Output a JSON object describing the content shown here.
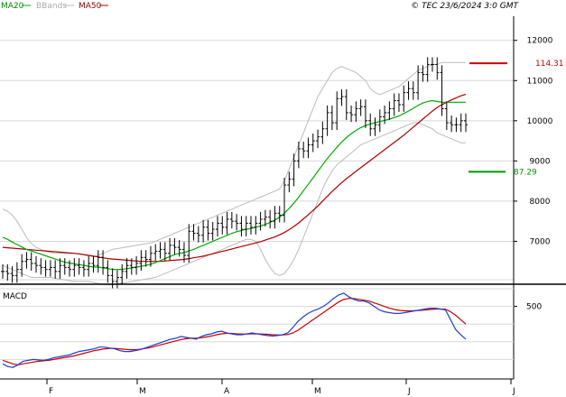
{
  "header": {
    "legend": [
      {
        "name": "MA20",
        "color": "#009900"
      },
      {
        "name": "BBands",
        "color": "#bbbbbb"
      },
      {
        "name": "MA50",
        "color": "#990000"
      }
    ],
    "copyright": "© TEC 23/6/2024 3:0 GMT"
  },
  "colors": {
    "price": "#000000",
    "ma20": "#00aa00",
    "ma50": "#aa0000",
    "bbands": "#bbbbbb",
    "grid": "#d8d8d8",
    "macd": "#1f3fcf",
    "signal": "#cc0000",
    "resistance": "#cc0000",
    "support": "#009900",
    "axis": "#000000"
  },
  "chart_data": [
    {
      "type": "line",
      "title": "",
      "x_labels": [
        "F",
        "M",
        "A",
        "M",
        "J",
        "J"
      ],
      "y_ticks": [
        "12000",
        "11000",
        "10000",
        "9000",
        "8000",
        "7000"
      ],
      "y_tick_values": [
        12000,
        11000,
        10000,
        9000,
        8000,
        7000
      ],
      "ylim": [
        6000,
        12600
      ],
      "grid": true,
      "annotations": [
        {
          "label": "114.31",
          "value": 11431,
          "kind": "resistance"
        },
        {
          "label": "87.29",
          "value": 8729,
          "kind": "support"
        }
      ],
      "series": [
        {
          "name": "price",
          "kind": "ohlc-close",
          "values": [
            6250,
            6200,
            6150,
            6300,
            6500,
            6550,
            6450,
            6400,
            6350,
            6300,
            6350,
            6250,
            6400,
            6350,
            6300,
            6400,
            6350,
            6300,
            6450,
            6400,
            6600,
            6350,
            6150,
            6000,
            6100,
            6250,
            6400,
            6350,
            6450,
            6600,
            6550,
            6700,
            6750,
            6800,
            6700,
            6900,
            6850,
            6800,
            6650,
            7250,
            7200,
            7150,
            7350,
            7200,
            7300,
            7450,
            7350,
            7550,
            7500,
            7450,
            7300,
            7450,
            7350,
            7450,
            7550,
            7600,
            7500,
            7700,
            7650,
            8400,
            8550,
            9000,
            9300,
            9250,
            9400,
            9500,
            9600,
            9800,
            10200,
            9950,
            10550,
            10600,
            10200,
            10150,
            10300,
            10350,
            10000,
            9800,
            9900,
            10100,
            10200,
            10300,
            10500,
            10400,
            10700,
            10800,
            10700,
            11200,
            11150,
            11400,
            11400,
            11200,
            10300,
            9950,
            9900,
            9900,
            10000,
            9900
          ]
        },
        {
          "name": "MA20",
          "kind": "ma",
          "values": [
            7100,
            7050,
            6980,
            6920,
            6860,
            6800,
            6760,
            6720,
            6680,
            6640,
            6600,
            6560,
            6520,
            6480,
            6460,
            6440,
            6420,
            6400,
            6380,
            6360,
            6360,
            6340,
            6320,
            6300,
            6300,
            6300,
            6320,
            6340,
            6360,
            6380,
            6400,
            6430,
            6470,
            6520,
            6570,
            6620,
            6670,
            6700,
            6720,
            6760,
            6800,
            6850,
            6900,
            6950,
            7000,
            7050,
            7100,
            7150,
            7200,
            7240,
            7270,
            7300,
            7320,
            7350,
            7380,
            7420,
            7470,
            7530,
            7600,
            7700,
            7820,
            7950,
            8100,
            8260,
            8420,
            8580,
            8740,
            8900,
            9060,
            9200,
            9340,
            9470,
            9580,
            9680,
            9760,
            9830,
            9880,
            9920,
            9950,
            9980,
            10010,
            10040,
            10080,
            10120,
            10180,
            10240,
            10310,
            10380,
            10440,
            10480,
            10500,
            10480,
            10460,
            10460,
            10460,
            10460,
            10460,
            10460
          ]
        },
        {
          "name": "MA50",
          "kind": "ma",
          "values": [
            6850,
            6840,
            6830,
            6820,
            6810,
            6800,
            6790,
            6780,
            6770,
            6760,
            6750,
            6740,
            6730,
            6720,
            6710,
            6700,
            6690,
            6670,
            6650,
            6630,
            6610,
            6590,
            6570,
            6560,
            6550,
            6540,
            6530,
            6520,
            6510,
            6500,
            6500,
            6500,
            6500,
            6500,
            6510,
            6520,
            6530,
            6540,
            6550,
            6570,
            6590,
            6610,
            6630,
            6660,
            6690,
            6720,
            6750,
            6780,
            6810,
            6840,
            6870,
            6900,
            6930,
            6960,
            6990,
            7030,
            7070,
            7110,
            7160,
            7220,
            7290,
            7370,
            7460,
            7560,
            7660,
            7770,
            7880,
            8000,
            8120,
            8240,
            8350,
            8460,
            8560,
            8650,
            8740,
            8830,
            8920,
            9010,
            9100,
            9190,
            9280,
            9370,
            9460,
            9550,
            9640,
            9740,
            9840,
            9940,
            10040,
            10140,
            10240,
            10330,
            10400,
            10460,
            10520,
            10570,
            10620,
            10660
          ]
        },
        {
          "name": "BB upper",
          "kind": "band",
          "values": [
            7800,
            7750,
            7650,
            7500,
            7300,
            7100,
            6950,
            6850,
            6800,
            6750,
            6720,
            6700,
            6700,
            6700,
            6700,
            6700,
            6680,
            6660,
            6640,
            6620,
            6650,
            6700,
            6750,
            6800,
            6820,
            6840,
            6860,
            6880,
            6900,
            6920,
            6940,
            6960,
            7000,
            7050,
            7100,
            7150,
            7200,
            7250,
            7300,
            7350,
            7400,
            7450,
            7500,
            7550,
            7600,
            7650,
            7700,
            7750,
            7800,
            7850,
            7900,
            7950,
            8000,
            8050,
            8100,
            8150,
            8200,
            8250,
            8300,
            8500,
            8800,
            9100,
            9400,
            9700,
            10000,
            10300,
            10600,
            10800,
            11000,
            11200,
            11300,
            11350,
            11300,
            11250,
            11200,
            11100,
            11000,
            10800,
            10700,
            10650,
            10700,
            10750,
            10800,
            10850,
            10950,
            11050,
            11150,
            11250,
            11300,
            11350,
            11400,
            11400,
            11450,
            11450,
            11450,
            11450,
            11450,
            11450
          ]
        },
        {
          "name": "BB lower",
          "kind": "band",
          "values": [
            6400,
            6350,
            6300,
            6250,
            6200,
            6150,
            6100,
            6100,
            6100,
            6100,
            6100,
            6080,
            6060,
            6040,
            6020,
            6000,
            6000,
            6000,
            6000,
            5980,
            5950,
            5930,
            5920,
            5920,
            5940,
            5960,
            5980,
            6000,
            6020,
            6040,
            6060,
            6080,
            6100,
            6150,
            6200,
            6250,
            6300,
            6350,
            6400,
            6450,
            6500,
            6550,
            6600,
            6650,
            6700,
            6750,
            6800,
            6850,
            6900,
            6950,
            7000,
            7050,
            7050,
            7000,
            6800,
            6550,
            6350,
            6200,
            6150,
            6200,
            6350,
            6550,
            6800,
            7100,
            7400,
            7700,
            8000,
            8300,
            8550,
            8750,
            8900,
            9000,
            9100,
            9200,
            9300,
            9400,
            9450,
            9500,
            9550,
            9600,
            9650,
            9700,
            9750,
            9800,
            9850,
            9900,
            9950,
            9950,
            9900,
            9850,
            9800,
            9700,
            9650,
            9600,
            9550,
            9500,
            9450,
            9450
          ]
        }
      ]
    },
    {
      "type": "line",
      "title": "MACD",
      "y_ticks": [
        "500"
      ],
      "y_tick_values": [
        500
      ],
      "ylim": [
        -300,
        700
      ],
      "grid": true,
      "series": [
        {
          "name": "MACD",
          "values": [
            -150,
            -180,
            -190,
            -160,
            -120,
            -110,
            -100,
            -105,
            -110,
            -100,
            -80,
            -70,
            -60,
            -50,
            -30,
            -10,
            0,
            10,
            20,
            40,
            40,
            30,
            20,
            0,
            -10,
            -10,
            0,
            10,
            30,
            50,
            70,
            90,
            110,
            130,
            140,
            160,
            150,
            140,
            130,
            160,
            180,
            190,
            210,
            220,
            200,
            190,
            180,
            180,
            190,
            200,
            190,
            180,
            170,
            165,
            170,
            180,
            200,
            260,
            330,
            380,
            420,
            450,
            470,
            500,
            540,
            590,
            630,
            650,
            610,
            580,
            560,
            560,
            540,
            500,
            460,
            440,
            430,
            420,
            420,
            430,
            440,
            450,
            460,
            470,
            480,
            480,
            470,
            460,
            350,
            240,
            180,
            130
          ]
        },
        {
          "name": "Signal",
          "values": [
            -110,
            -130,
            -150,
            -160,
            -150,
            -140,
            -130,
            -120,
            -115,
            -110,
            -100,
            -90,
            -80,
            -70,
            -60,
            -45,
            -30,
            -15,
            0,
            10,
            20,
            25,
            25,
            20,
            15,
            10,
            10,
            15,
            25,
            35,
            50,
            65,
            80,
            95,
            110,
            125,
            135,
            140,
            140,
            145,
            155,
            165,
            180,
            190,
            195,
            195,
            190,
            188,
            188,
            190,
            190,
            188,
            185,
            180,
            178,
            178,
            182,
            200,
            230,
            270,
            310,
            350,
            390,
            430,
            470,
            510,
            550,
            580,
            590,
            590,
            580,
            570,
            560,
            540,
            520,
            500,
            480,
            465,
            455,
            450,
            450,
            452,
            455,
            460,
            465,
            470,
            470,
            468,
            440,
            400,
            350,
            300
          ]
        }
      ]
    }
  ]
}
